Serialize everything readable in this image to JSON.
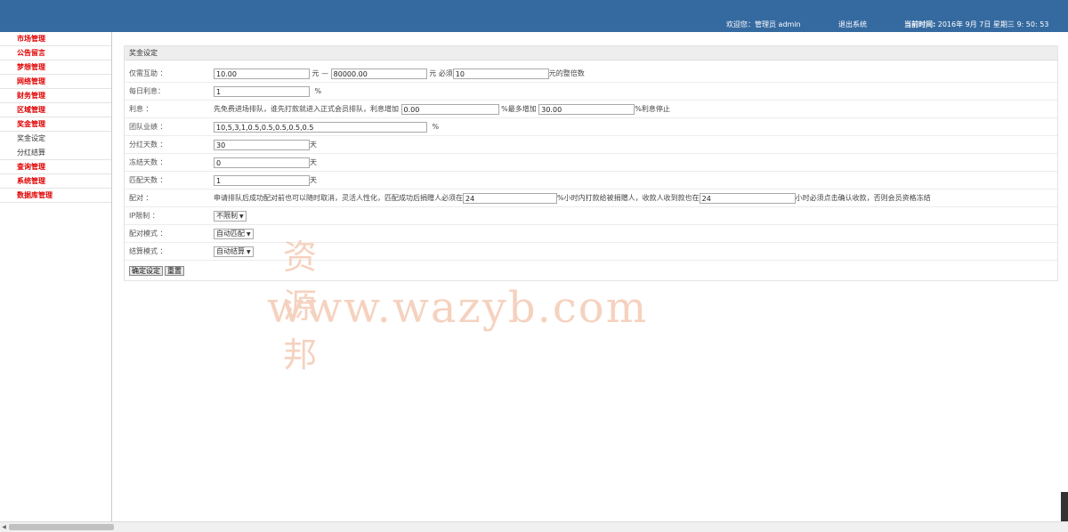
{
  "header": {
    "welcome": "欢迎您：管理员 admin",
    "logout": "退出系统",
    "time_label": "当前时间:",
    "time_value": "2016年 9月 7日 星期三 9: 50: 53",
    "bg_color": "#356aa0"
  },
  "sidebar": {
    "items": [
      {
        "label": "市场管理",
        "type": "category"
      },
      {
        "label": "公告留言",
        "type": "category"
      },
      {
        "label": "梦想管理",
        "type": "category"
      },
      {
        "label": "网络管理",
        "type": "category"
      },
      {
        "label": "财务管理",
        "type": "category"
      },
      {
        "label": "区域管理",
        "type": "category"
      },
      {
        "label": "奖金管理",
        "type": "category"
      },
      {
        "label": "奖金设定",
        "type": "sub"
      },
      {
        "label": "分红结算",
        "type": "sub"
      },
      {
        "label": "查询管理",
        "type": "category"
      },
      {
        "label": "系统管理",
        "type": "category"
      },
      {
        "label": "数据库管理",
        "type": "category"
      }
    ],
    "category_color": "#e00000"
  },
  "panel": {
    "title": "奖金设定",
    "rows": {
      "help": {
        "label": "仅需互助 ：",
        "min": "10.00",
        "sep": "元 —",
        "max": "80000.00",
        "must": "元 必须",
        "multiple": "10",
        "tail": "元的整倍数"
      },
      "daily": {
        "label": "每日利息：",
        "value": "1",
        "unit": "%"
      },
      "interest": {
        "label": "利息 ：",
        "text": "先免费进场排队，谁先打款就进入正式会员排队，利息增加",
        "inc": "0.00",
        "max_text": "%最多增加",
        "max": "30.00",
        "tail": "%利息停止"
      },
      "team": {
        "label": "团队业绩 ：",
        "value": "10,5,3,1,0.5,0.5,0.5,0.5,0.5",
        "unit": "%"
      },
      "bonus_days": {
        "label": "分红天数 ：",
        "value": "30",
        "unit": "天"
      },
      "freeze_days": {
        "label": "冻结天数 ：",
        "value": "0",
        "unit": "天"
      },
      "match_days": {
        "label": "匹配天数 ：",
        "value": "1",
        "unit": "天"
      },
      "pair": {
        "label": "配对 ：",
        "text1": "申请排队后成功配对前也可以随时取消，灵活人性化，匹配成功后捐赠人必须在",
        "hours1": "24",
        "text2": "%小时内打款给被捐赠人，收款人收到款也在",
        "hours2": "24",
        "text3": "小时必须点击确认收款，否则会员资格冻结"
      },
      "ip": {
        "label": "IP限制 ：",
        "value": "不限制"
      },
      "pair_mode": {
        "label": "配对模式 ：",
        "value": "自动匹配"
      },
      "settle_mode": {
        "label": "结算模式 ：",
        "value": "自动结算"
      }
    },
    "buttons": {
      "submit": "确定设定",
      "reset": "重置"
    }
  },
  "watermark": {
    "line1": "资源邦",
    "line2": "www.wazyb.com",
    "color": "#f4cbb5"
  }
}
